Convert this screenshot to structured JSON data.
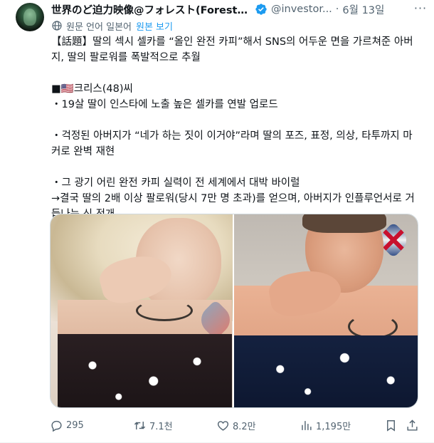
{
  "author": {
    "name": "世界のど迫力映像@フォレスト(Forest)...",
    "handle": "@investor...",
    "date": "6월 13일"
  },
  "translation": {
    "note": "원문 언어 일본어",
    "show_original": "원본 보기"
  },
  "body_lines": [
    "【話題】딸의 섹시 셀카를 “올인 완전 카피”해서 SNS의 어두운 면을 가르쳐준 아버",
    "지, 딸의 팔로워를 폭발적으로 추월",
    "",
    "■🇺🇸크리스(48)씨",
    "・19살 딸이 인스타에 노출 높은 셀카를 연발 업로드",
    "",
    "・걱정된 아버지가 “네가 하는 짓이 이거야”라며 딸의 포즈, 표정, 의상, 타투까지 마",
    "커로 완벽 재현",
    "",
    "・그 광기 어린 완전 카피 실력이 전 세계에서 대박 바이럴",
    "→결국 딸의 2배 이상 팔로워(당시 7만 명 초과)를 얻으며, 아버지가 인플루언서로 거",
    "듭나는 신 전개"
  ],
  "actions": {
    "replies": "295",
    "retweets": "7.1천",
    "likes": "8.2만",
    "views": "1,195만"
  },
  "icons": {
    "verified": "verified-badge-icon",
    "more": "more-icon",
    "globe": "globe-icon",
    "reply": "reply-icon",
    "retweet": "retweet-icon",
    "like": "heart-icon",
    "views": "views-icon",
    "bookmark": "bookmark-icon",
    "share": "share-icon"
  },
  "colors": {
    "text": "#0f1419",
    "secondary": "#536471",
    "accent": "#1d9bf0",
    "border": "#cfd9de"
  }
}
